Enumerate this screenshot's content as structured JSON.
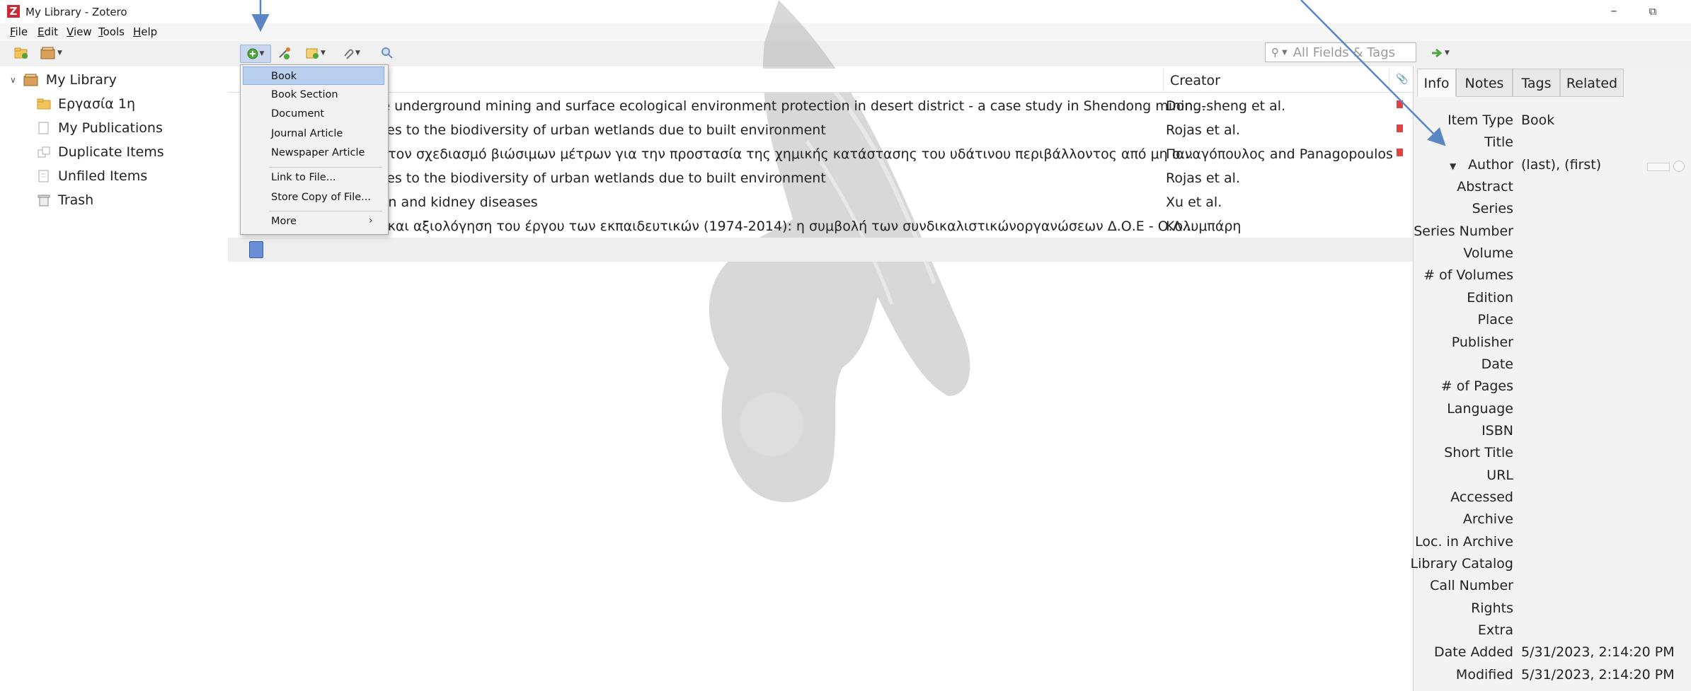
{
  "window": {
    "title": "My Library - Zotero",
    "logo": "Z"
  },
  "menubar": [
    "File",
    "Edit",
    "View",
    "Tools",
    "Help"
  ],
  "toolbar": {
    "search_placeholder": "All Fields & Tags",
    "icons": [
      "new-collection-icon",
      "new-library-icon",
      "new-item-icon",
      "add-by-identifier-icon",
      "new-note-icon",
      "add-attachment-icon",
      "advanced-search-icon",
      "sync-icon"
    ]
  },
  "collections": {
    "library": "My Library",
    "items": [
      "Εργασία 1η",
      "My Publications",
      "Duplicate Items",
      "Unfiled Items",
      "Trash"
    ]
  },
  "items_table": {
    "columns": {
      "creator": "Creator"
    },
    "rows": [
      {
        "title": "cale underground mining and surface ecological environment protection in desert district - a case study in Shendong minin...",
        "creator": "Dong-sheng et al."
      },
      {
        "title": "ances to the biodiversity of urban wetlands due to built environment",
        "creator": "Rojas et al."
      },
      {
        "title": "για τον σχεδιασμό βιώσιμων μέτρων για την προστασία της χημικής κατάστασης του υδάτινου περιβάλλοντος από μη σ...",
        "creator": "Παναγόπουλος and Panagopoulos"
      },
      {
        "title": "ances to the biodiversity of urban wetlands due to built environment",
        "creator": "Rojas et al."
      },
      {
        "title": "ution and kidney diseases",
        "creator": "Xu et al."
      },
      {
        "title": "ική και αξιολόγηση του έργου των εκπαιδευτικών (1974-2014): η συμβολή των συνδικαλιστικώνοργανώσεων Δ.Ο.Ε - Ο.Λ...",
        "creator": "Κολυμπάρη"
      }
    ]
  },
  "new_item_menu": {
    "items": [
      "Book",
      "Book Section",
      "Document",
      "Journal Article",
      "Newspaper Article"
    ],
    "file_items": [
      "Link to File...",
      "Store Copy of File..."
    ],
    "more": "More",
    "selected": "Book"
  },
  "item_pane": {
    "tabs": [
      "Info",
      "Notes",
      "Tags",
      "Related"
    ],
    "active_tab": "Info",
    "fields": [
      {
        "label": "Item Type",
        "value": "Book"
      },
      {
        "label": "Title",
        "value": ""
      },
      {
        "label": "Author",
        "value": "(last), (first)"
      },
      {
        "label": "Abstract",
        "value": ""
      },
      {
        "label": "Series",
        "value": ""
      },
      {
        "label": "Series Number",
        "value": ""
      },
      {
        "label": "Volume",
        "value": ""
      },
      {
        "label": "# of Volumes",
        "value": ""
      },
      {
        "label": "Edition",
        "value": ""
      },
      {
        "label": "Place",
        "value": ""
      },
      {
        "label": "Publisher",
        "value": ""
      },
      {
        "label": "Date",
        "value": ""
      },
      {
        "label": "# of Pages",
        "value": ""
      },
      {
        "label": "Language",
        "value": ""
      },
      {
        "label": "ISBN",
        "value": ""
      },
      {
        "label": "Short Title",
        "value": ""
      },
      {
        "label": "URL",
        "value": ""
      },
      {
        "label": "Accessed",
        "value": ""
      },
      {
        "label": "Archive",
        "value": ""
      },
      {
        "label": "Loc. in Archive",
        "value": ""
      },
      {
        "label": "Library Catalog",
        "value": ""
      },
      {
        "label": "Call Number",
        "value": ""
      },
      {
        "label": "Rights",
        "value": ""
      },
      {
        "label": "Extra",
        "value": ""
      },
      {
        "label": "Date Added",
        "value": "5/31/2023, 2:14:20 PM"
      },
      {
        "label": "Modified",
        "value": "5/31/2023, 2:14:20 PM"
      }
    ]
  },
  "colors": {
    "accent_selection": "#b8d0ee",
    "annotation_arrow": "#5a86c4",
    "pdf_icon": "#d44444"
  }
}
